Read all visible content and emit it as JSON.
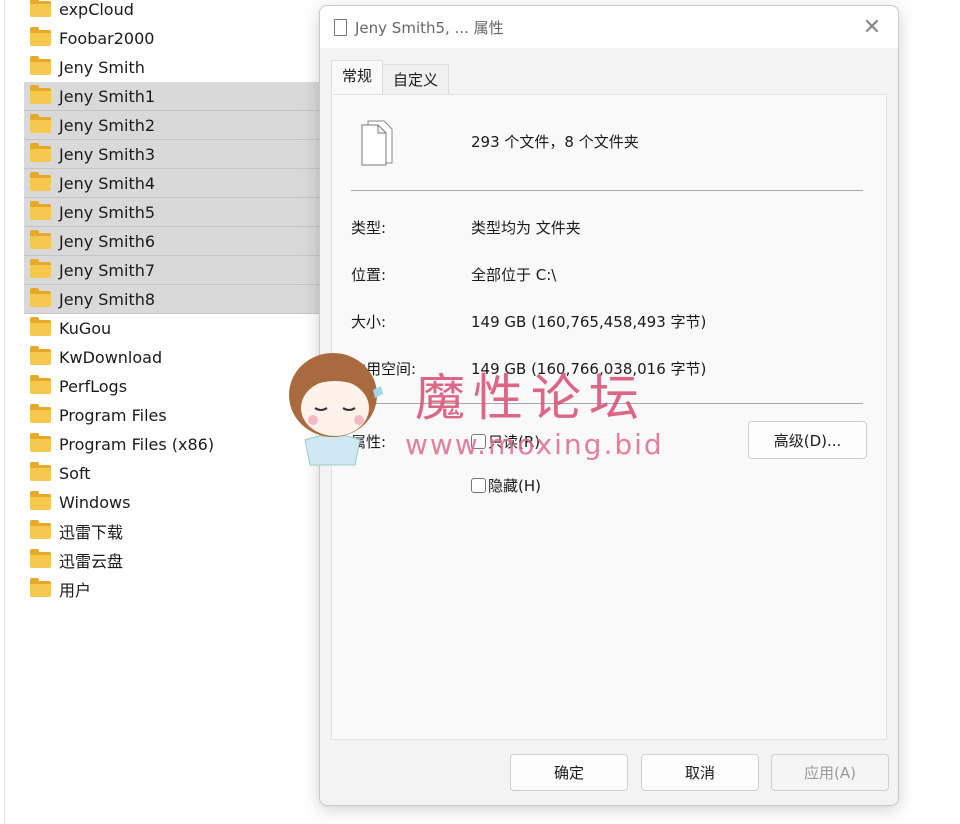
{
  "files": [
    "expCloud",
    "Foobar2000",
    "Jeny Smith",
    "Jeny Smith1",
    "Jeny Smith2",
    "Jeny Smith3",
    "Jeny Smith4",
    "Jeny Smith5",
    "Jeny Smith6",
    "Jeny Smith7",
    "Jeny Smith8",
    "KuGou",
    "KwDownload",
    "PerfLogs",
    "Program Files",
    "Program Files (x86)",
    "Soft",
    "Windows",
    "迅雷下载",
    "迅雷云盘",
    "用户"
  ],
  "selected": [
    "Jeny Smith1",
    "Jeny Smith2",
    "Jeny Smith3",
    "Jeny Smith4",
    "Jeny Smith5",
    "Jeny Smith6",
    "Jeny Smith7",
    "Jeny Smith8"
  ],
  "dialog": {
    "title": "Jeny Smith5, ... 属性",
    "tabs": [
      "常规",
      "自定义"
    ],
    "summary": "293 个文件，8 个文件夹",
    "fields": [
      {
        "label": "类型:",
        "value": "类型均为 文件夹"
      },
      {
        "label": "位置:",
        "value": "全部位于 C:\\"
      },
      {
        "label": "大小:",
        "value": "149 GB (160,765,458,493 字节)"
      },
      {
        "label": "占用空间:",
        "value": "149 GB (160,766,038,016 字节)"
      }
    ],
    "attributes_label": "属性:",
    "readonly": "只读(R)",
    "hidden": "隐藏(H)",
    "advanced": "高级(D)...",
    "ok": "确定",
    "cancel": "取消",
    "apply": "应用(A)"
  },
  "watermark": {
    "title": "魔性论坛",
    "url": "www.moxing.bid"
  }
}
